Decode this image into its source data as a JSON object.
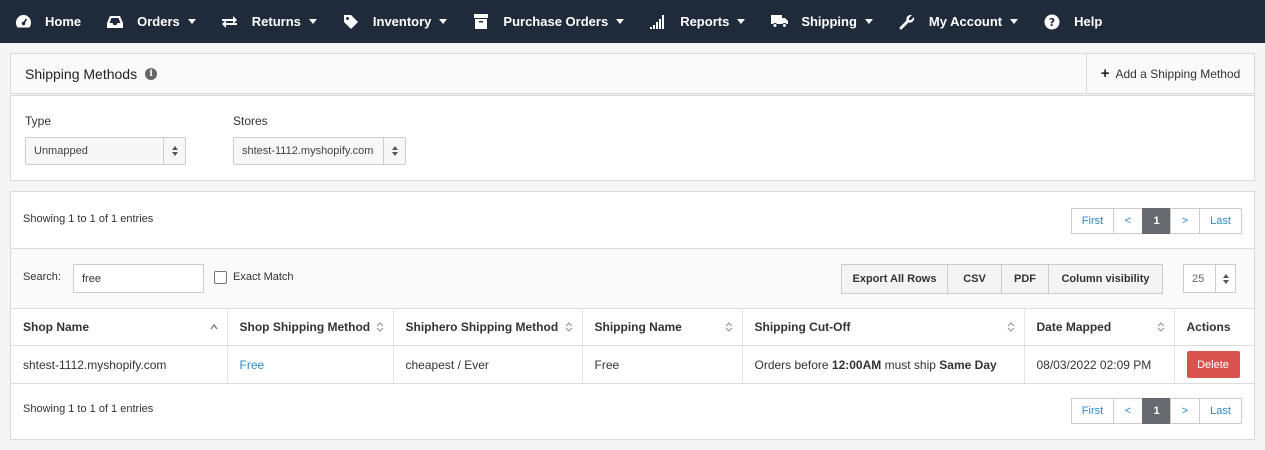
{
  "nav": {
    "items": [
      {
        "label": "Home",
        "icon": "dashboard-icon",
        "caret": false
      },
      {
        "label": "Orders",
        "icon": "inbox-icon",
        "caret": true
      },
      {
        "label": "Returns",
        "icon": "exchange-icon",
        "caret": true
      },
      {
        "label": "Inventory",
        "icon": "tag-icon",
        "caret": true
      },
      {
        "label": "Purchase Orders",
        "icon": "archive-icon",
        "caret": true
      },
      {
        "label": "Reports",
        "icon": "signal-icon",
        "caret": true
      },
      {
        "label": "Shipping",
        "icon": "truck-icon",
        "caret": true
      },
      {
        "label": "My Account",
        "icon": "wrench-icon",
        "caret": true
      },
      {
        "label": "Help",
        "icon": "help-icon",
        "caret": false
      }
    ],
    "background": "#1f2b3b"
  },
  "header": {
    "title": "Shipping Methods",
    "add_label": "Add a Shipping Method"
  },
  "filters": {
    "type_label": "Type",
    "type_value": "Unmapped",
    "stores_label": "Stores",
    "stores_value": "shtest-1112.myshopify.com"
  },
  "table_info": {
    "top": "Showing 1 to 1 of 1 entries",
    "bottom": "Showing 1 to 1 of 1 entries"
  },
  "pager": {
    "first": "First",
    "prev": "<",
    "current": "1",
    "next": ">",
    "last": "Last"
  },
  "toolbar": {
    "search_label": "Search:",
    "search_value": "free",
    "exact_match_label": "Exact Match",
    "export_all": "Export All Rows",
    "csv": "CSV",
    "pdf": "PDF",
    "column_visibility": "Column visibility",
    "per_page": "25"
  },
  "columns": [
    "Shop Name",
    "Shop Shipping Method",
    "Shiphero Shipping Method",
    "Shipping Name",
    "Shipping Cut-Off",
    "Date Mapped",
    "Actions"
  ],
  "rows": [
    {
      "shop_name": "shtest-1112.myshopify.com",
      "shop_shipping_method": "Free",
      "shiphero_method": "cheapest / Ever",
      "shipping_name": "Free",
      "cutoff_prefix": "Orders before",
      "cutoff_time": "12:00AM",
      "cutoff_mid": "must ship",
      "cutoff_day": "Same Day",
      "date_mapped": "08/03/2022 02:09 PM",
      "action": "Delete"
    }
  ],
  "colors": {
    "link": "#2a8bc4",
    "delete": "#d9534f",
    "pager_active": "#666a6f"
  }
}
